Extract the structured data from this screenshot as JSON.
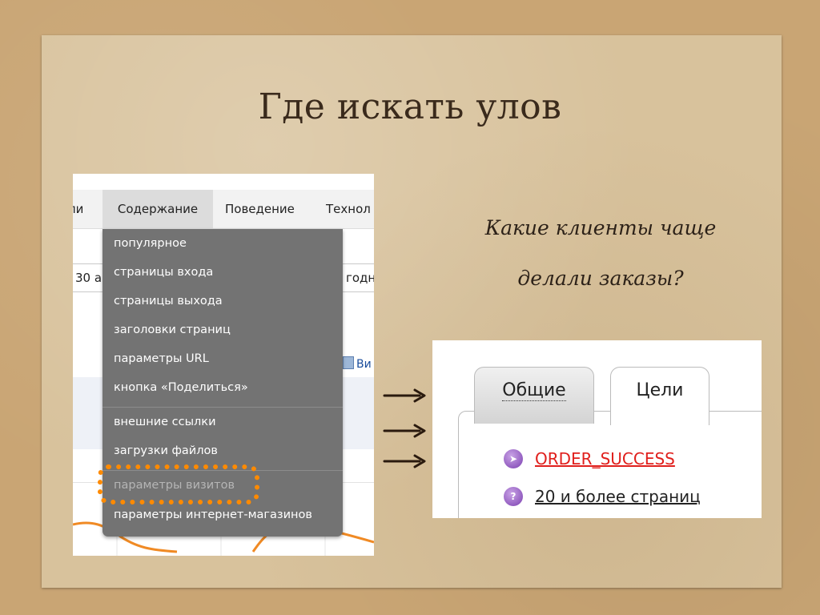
{
  "slide": {
    "title": "Где искать улов",
    "caption_line1": "Какие клиенты чаще",
    "caption_line2": "делали заказы?"
  },
  "analytics_screenshot": {
    "nav": {
      "partial_left": "ли",
      "content": "Содержание",
      "behavior": "Поведение",
      "tech_partial": "Технол"
    },
    "date_partial": "30 ав",
    "today_partial": "годн",
    "view_link_partial": "Ви",
    "menu_items_group1": [
      "популярное",
      "страницы входа",
      "страницы выхода",
      "заголовки страниц",
      "параметры URL",
      "кнопка «Поделиться»"
    ],
    "menu_items_group2": [
      "внешние ссылки",
      "загрузки файлов"
    ],
    "menu_items_group3": [
      "параметры визитов",
      "параметры интернет-магазинов"
    ],
    "highlight_color": "#ff8a00"
  },
  "goals_screenshot": {
    "tabs": {
      "general": "Общие",
      "goals": "Цели"
    },
    "goals": [
      {
        "label": "ORDER_SUCCESS",
        "color": "#e0201d",
        "icon": "cursor-icon"
      },
      {
        "label": "20 и более страниц",
        "color": "#222222",
        "icon": "pages-icon"
      }
    ]
  }
}
